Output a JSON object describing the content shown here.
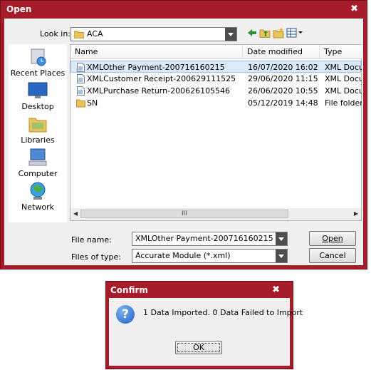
{
  "open_dialog": {
    "title": "Open",
    "close_glyph": "✖",
    "look_in": {
      "label": "Look in:",
      "value": "ACA"
    },
    "toolbar_icons": [
      "back-icon",
      "up-folder-icon",
      "new-folder-icon",
      "view-menu-icon"
    ],
    "places": [
      {
        "label": "Recent Places",
        "icon": "recent-places-icon"
      },
      {
        "label": "Desktop",
        "icon": "desktop-icon"
      },
      {
        "label": "Libraries",
        "icon": "libraries-icon"
      },
      {
        "label": "Computer",
        "icon": "computer-icon"
      },
      {
        "label": "Network",
        "icon": "network-icon"
      }
    ],
    "columns": [
      "Name",
      "Date modified",
      "Type"
    ],
    "files": [
      {
        "name": "XMLOther Payment-200716160215",
        "date": "16/07/2020 16:02",
        "type": "XML Docum",
        "icon": "xml-file-icon",
        "selected": true
      },
      {
        "name": "XMLCustomer Receipt-200629111525",
        "date": "29/06/2020 11:15",
        "type": "XML Docum",
        "icon": "xml-file-icon",
        "selected": false
      },
      {
        "name": "XMLPurchase Return-200626105546",
        "date": "26/06/2020 10:55",
        "type": "XML Docum",
        "icon": "xml-file-icon",
        "selected": false
      },
      {
        "name": "SN",
        "date": "05/12/2019 14:48",
        "type": "File folder",
        "icon": "folder-icon",
        "selected": false
      }
    ],
    "scroll_grip": "III",
    "file_name": {
      "label": "File name:",
      "value": "XMLOther Payment-200716160215"
    },
    "file_type": {
      "label": "Files of type:",
      "value": "Accurate Module (*.xml)"
    },
    "open_button": "Open",
    "cancel_button": "Cancel"
  },
  "confirm_dialog": {
    "title": "Confirm",
    "close_glyph": "✖",
    "message": "1 Data Imported. 0 Data Failed to Import",
    "ok_button": "OK",
    "icon": "question-icon"
  },
  "colors": {
    "title_bar": "#a61c2b",
    "selection": "#dce9f8"
  }
}
